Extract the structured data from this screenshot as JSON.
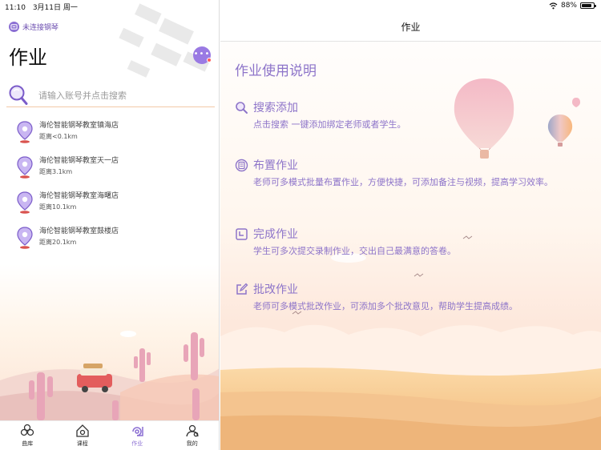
{
  "status_bar": {
    "time": "11:10",
    "date": "3月11日 周一",
    "battery": "88%",
    "battery_level": 0.88
  },
  "left": {
    "connection_status": "未连接钢琴",
    "title": "作业",
    "search_placeholder": "请输入账号并点击搜索",
    "stores": [
      {
        "name": "海伦智能钢琴教室镇海店",
        "distance": "距离<0.1km"
      },
      {
        "name": "海伦智能钢琴教室天一店",
        "distance": "距离3.1km"
      },
      {
        "name": "海伦智能钢琴教室海曙店",
        "distance": "距离10.1km"
      },
      {
        "name": "海伦智能钢琴教室鼓楼店",
        "distance": "距离20.1km"
      }
    ],
    "tabs": [
      {
        "label": "曲库",
        "icon": "music-library-icon",
        "active": false
      },
      {
        "label": "课程",
        "icon": "course-icon",
        "active": false
      },
      {
        "label": "作业",
        "icon": "homework-icon",
        "active": true
      },
      {
        "label": "我的",
        "icon": "profile-icon",
        "active": false
      }
    ]
  },
  "right": {
    "nav_title": "作业",
    "intro_title": "作业使用说明",
    "features": [
      {
        "icon": "search-icon",
        "title": "搜索添加",
        "desc": "点击搜索 一键添加绑定老师或者学生。"
      },
      {
        "icon": "assign-icon",
        "title": "布置作业",
        "desc": "老师可多模式批量布置作业，方便快捷，可添加备注与视频，提高学习效率。"
      },
      {
        "icon": "complete-icon",
        "title": "完成作业",
        "desc": "学生可多次提交录制作业，交出自己最满意的答卷。"
      },
      {
        "icon": "edit-icon",
        "title": "批改作业",
        "desc": "老师可多模式批改作业，可添加多个批改意见，帮助学生提高成绩。"
      }
    ]
  },
  "colors": {
    "accent": "#8b6fd3",
    "text_purple": "#8d74c9",
    "sand": "#f4c48f"
  }
}
